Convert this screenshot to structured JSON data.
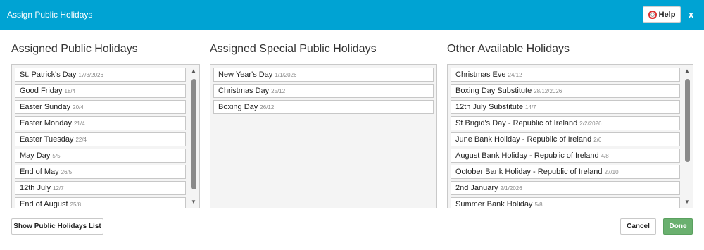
{
  "header": {
    "title": "Assign Public Holidays",
    "help_label": "Help",
    "close_label": "x"
  },
  "columns": {
    "assigned": {
      "title": "Assigned Public Holidays",
      "items": [
        {
          "name": "St. Patrick's Day",
          "date": "17/3/2026"
        },
        {
          "name": "Good Friday",
          "date": "18/4"
        },
        {
          "name": "Easter Sunday",
          "date": "20/4"
        },
        {
          "name": "Easter Monday",
          "date": "21/4"
        },
        {
          "name": "Easter Tuesday",
          "date": "22/4"
        },
        {
          "name": "May Day",
          "date": "5/5"
        },
        {
          "name": "End of May",
          "date": "26/5"
        },
        {
          "name": "12th July",
          "date": "12/7"
        },
        {
          "name": "End of August",
          "date": "25/8"
        }
      ]
    },
    "special": {
      "title": "Assigned Special Public Holidays",
      "items": [
        {
          "name": "New Year's Day",
          "date": "1/1/2026"
        },
        {
          "name": "Christmas Day",
          "date": "25/12"
        },
        {
          "name": "Boxing Day",
          "date": "26/12"
        }
      ]
    },
    "available": {
      "title": "Other Available Holidays",
      "items": [
        {
          "name": "Christmas Eve",
          "date": "24/12"
        },
        {
          "name": "Boxing Day Substitute",
          "date": "28/12/2026"
        },
        {
          "name": "12th July Substitute",
          "date": "14/7"
        },
        {
          "name": "St Brigid's Day - Republic of Ireland",
          "date": "2/2/2026"
        },
        {
          "name": "June Bank Holiday - Republic of Ireland",
          "date": "2/6"
        },
        {
          "name": "August Bank Holiday - Republic of Ireland",
          "date": "4/8"
        },
        {
          "name": "October Bank Holiday - Republic of Ireland",
          "date": "27/10"
        },
        {
          "name": "2nd January",
          "date": "2/1/2026"
        },
        {
          "name": "Summer Bank Holiday",
          "date": "5/8"
        }
      ]
    }
  },
  "footer": {
    "show_list_label": "Show Public Holidays List",
    "cancel_label": "Cancel",
    "done_label": "Done"
  },
  "icons": {
    "up": "▲",
    "down": "▼"
  },
  "colors": {
    "header_bg": "#00a3d3",
    "done_bg": "#6ab06f"
  }
}
